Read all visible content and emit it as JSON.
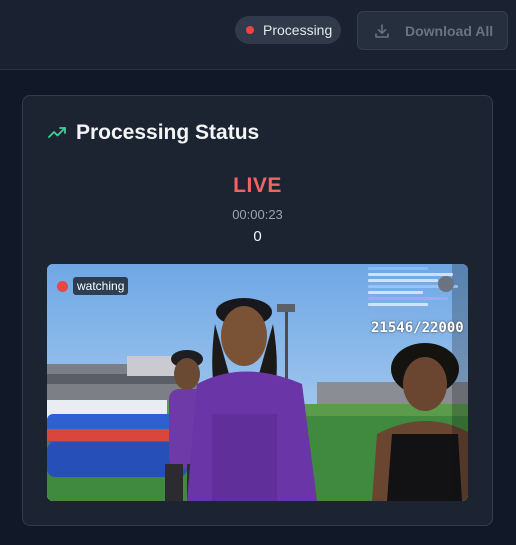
{
  "header": {
    "status_label": "Processing",
    "status_color": "#ef4444",
    "download_label": "Download All",
    "download_icon": "download-icon"
  },
  "card": {
    "title": "Processing Status",
    "title_icon": "trending-up-icon",
    "live_label": "LIVE",
    "elapsed": "00:00:23",
    "count": "0"
  },
  "video": {
    "badge_label": "watching",
    "counter_text": "21546/22000"
  },
  "colors": {
    "accent_green": "#34d399",
    "live_red": "#f26464",
    "background": "#111827",
    "card_bg": "#1c2331"
  }
}
